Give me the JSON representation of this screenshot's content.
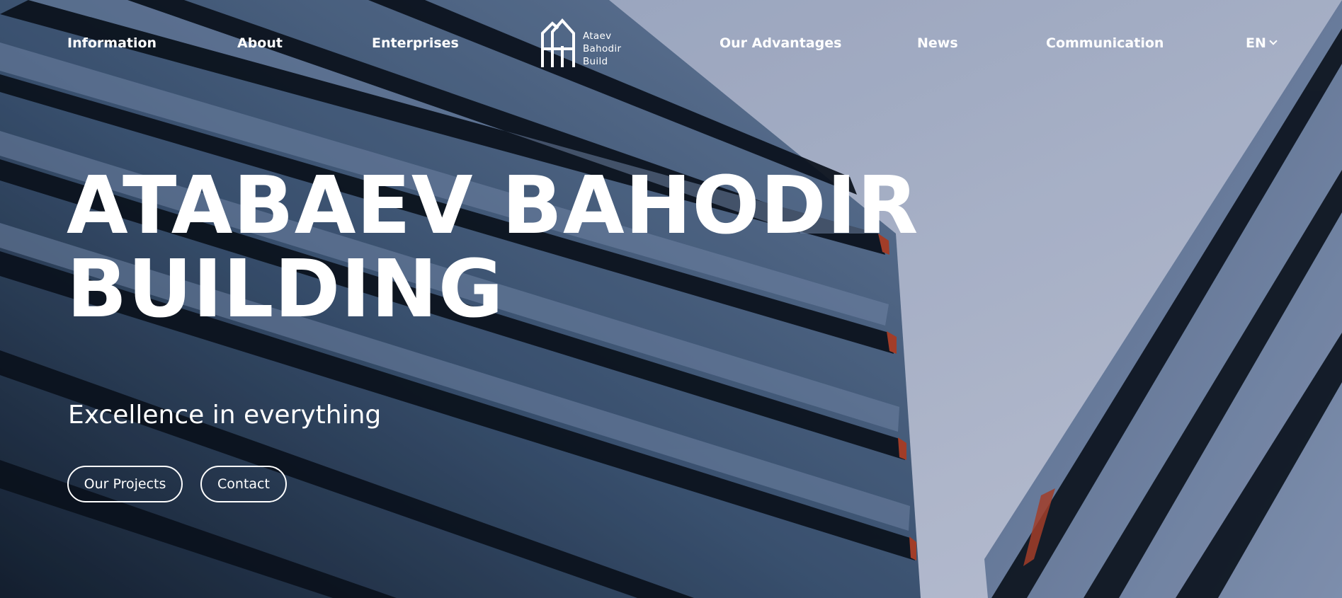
{
  "nav": {
    "items": [
      {
        "label": "Information"
      },
      {
        "label": "About"
      },
      {
        "label": "Enterprises"
      },
      {
        "label": "Our Advantages"
      },
      {
        "label": "News"
      },
      {
        "label": "Communication"
      }
    ],
    "language": "EN"
  },
  "logo": {
    "line1": "Ataev",
    "line2": "Bahodir",
    "line3": "Build",
    "icon": "building-logo-icon"
  },
  "hero": {
    "title_line1": "ATABAEV BAHODIR",
    "title_line2": "BUILDING",
    "subtitle": "Excellence in everything",
    "buttons": {
      "projects": "Our Projects",
      "contact": "Contact"
    }
  },
  "colors": {
    "text": "#ffffff",
    "sky": "#c4cce2",
    "facade_dark": "#0d1622",
    "facade_mid": "#4a6282",
    "accent_orange": "#b8442a"
  }
}
